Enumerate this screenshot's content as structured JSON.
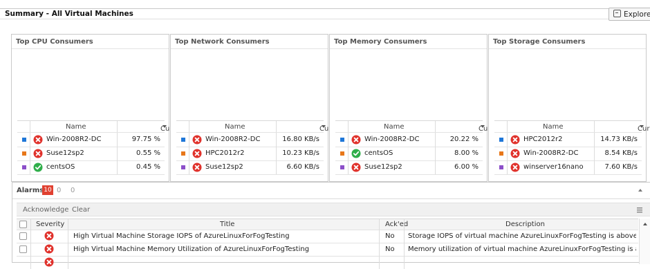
{
  "header": {
    "title": "Summary - All Virtual Machines",
    "explore_label": "Explore"
  },
  "panels": [
    {
      "title": "Top CPU Consumers",
      "col_name": "Name",
      "col_current": "Current",
      "rows": [
        {
          "color": "#1f77d8",
          "status": "error",
          "name": "Win-2008R2-DC",
          "value": "97.75 %"
        },
        {
          "color": "#e7771a",
          "status": "error",
          "name": "Suse12sp2",
          "value": "0.55 %"
        },
        {
          "color": "#8c4fc9",
          "status": "ok",
          "name": "centsOS",
          "value": "0.45 %"
        }
      ]
    },
    {
      "title": "Top Network Consumers",
      "col_name": "Name",
      "col_current": "Current",
      "rows": [
        {
          "color": "#1f77d8",
          "status": "error",
          "name": "Win-2008R2-DC",
          "value": "16.80 KB/s"
        },
        {
          "color": "#e7771a",
          "status": "error",
          "name": "HPC2012r2",
          "value": "10.23 KB/s"
        },
        {
          "color": "#8c4fc9",
          "status": "error",
          "name": "Suse12sp2",
          "value": "6.60 KB/s"
        }
      ]
    },
    {
      "title": "Top Memory Consumers",
      "col_name": "Name",
      "col_current": "Current",
      "rows": [
        {
          "color": "#1f77d8",
          "status": "error",
          "name": "Win-2008R2-DC",
          "value": "20.22 %"
        },
        {
          "color": "#e7771a",
          "status": "ok",
          "name": "centsOS",
          "value": "8.00 %"
        },
        {
          "color": "#8c4fc9",
          "status": "error",
          "name": "Suse12sp2",
          "value": "6.00 %"
        }
      ]
    },
    {
      "title": "Top Storage Consumers",
      "col_name": "Name",
      "col_current": "Current",
      "rows": [
        {
          "color": "#1f77d8",
          "status": "error",
          "name": "HPC2012r2",
          "value": "14.73 KB/s"
        },
        {
          "color": "#e7771a",
          "status": "error",
          "name": "Win-2008R2-DC",
          "value": "8.54 KB/s"
        },
        {
          "color": "#8c4fc9",
          "status": "error",
          "name": "winserver16nano",
          "value": "7.60 KB/s"
        }
      ]
    }
  ],
  "alarms": {
    "title": "Alarms",
    "critical_count": "10",
    "warning_count": "0",
    "info_count": "0",
    "acknowledge_label": "Acknowledge",
    "clear_label": "Clear",
    "columns": {
      "severity": "Severity",
      "title": "Title",
      "acked": "Ack'ed",
      "description": "Description"
    },
    "rows": [
      {
        "severity": "error",
        "title": "High Virtual Machine Storage IOPS of AzureLinuxForFogTesting",
        "acked": "No",
        "description": "Storage IOPS of virtual machine AzureLinuxForFogTesting is above ..."
      },
      {
        "severity": "error",
        "title": "High Virtual Machine Memory Utilization of AzureLinuxForFogTesting",
        "acked": "No",
        "description": "Memory utilization of virtual machine AzureLinuxForFogTesting is ab..."
      }
    ]
  },
  "colors": {
    "error": "#e0312b",
    "ok": "#2fae4a",
    "count_badge": "#e04030"
  }
}
